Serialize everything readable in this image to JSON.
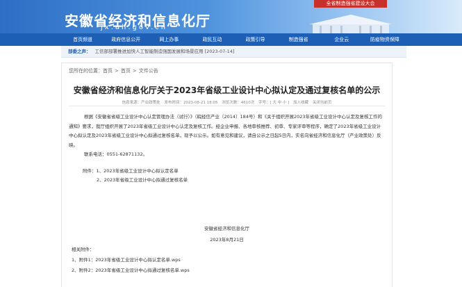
{
  "header": {
    "site_name": "安徽省经济和信息化厅",
    "site_domain": "jx.ah.gov.cn",
    "slogan": "全省制造强省建设大会"
  },
  "nav": {
    "items": [
      "首页频道",
      "政府信息公开",
      "网上办事",
      "政民互动",
      "政策引导",
      "制造强省",
      "企业云",
      "防疫物资保障"
    ]
  },
  "ticker": {
    "label": "部委之声：",
    "text": "工信部部署推进加快人工智能制造强国发展和场景应用 [2023-07-14]"
  },
  "breadcrumb": {
    "prefix": "您所在的位置：",
    "items": [
      "首页",
      "首页",
      "文件公告"
    ],
    "separator": ">"
  },
  "article": {
    "title": "安徽省经济和信息化厅关于2023年省级工业设计中心拟认定及通过复核名单的公示",
    "meta": {
      "source": "信息来源：产业政策处",
      "date": "发布时间：2023-08-21 18:05",
      "views": "浏览次数：4610次",
      "font_size": "字号：[ 大 中 小 ]",
      "favorite": "加入收藏",
      "close": "关闭当前页"
    },
    "paragraph1": "根据《安徽省省级工业设计中心认定管理办法（试行）》（皖经信产业〔2014〕184号）和《关于组织开展2023年省级工业设计中心认定及复核工作的通知》要求，我厅组织开展了2023年省级工业设计中心认定及复核工作。经企业申报、各地审核推荐、初审、专家评审等程序，确定了2023年省级工业设计中心拟认定及2023年省级工业设计中心拟通过复核名单，现予以公示。如有意见和建议，请自公示之日起5日内，实名向省经济和信息化厅（产业政策处）反映。",
    "contact": "联系电话：0551-62871132。",
    "attachments_label": "附件：1、2023年省级工业设计中心拟认定名单",
    "attachment2": "2、2023年省级工业设计中心拟通过复核名单",
    "signature_org": "安徽省经济和信息化厅",
    "signature_date": "2023年8月21日",
    "related_label": "相关附件：",
    "related_files": [
      "1、附件1：2023年省级工业设计中心拟认定名单.wps",
      "2、附件2：2023年省级工业设计中心拟通过复核名单.wps"
    ]
  },
  "colors": {
    "nav_bg": "#1d5fb5",
    "slogan_bg": "#c8302c",
    "title_text": "#222222"
  }
}
